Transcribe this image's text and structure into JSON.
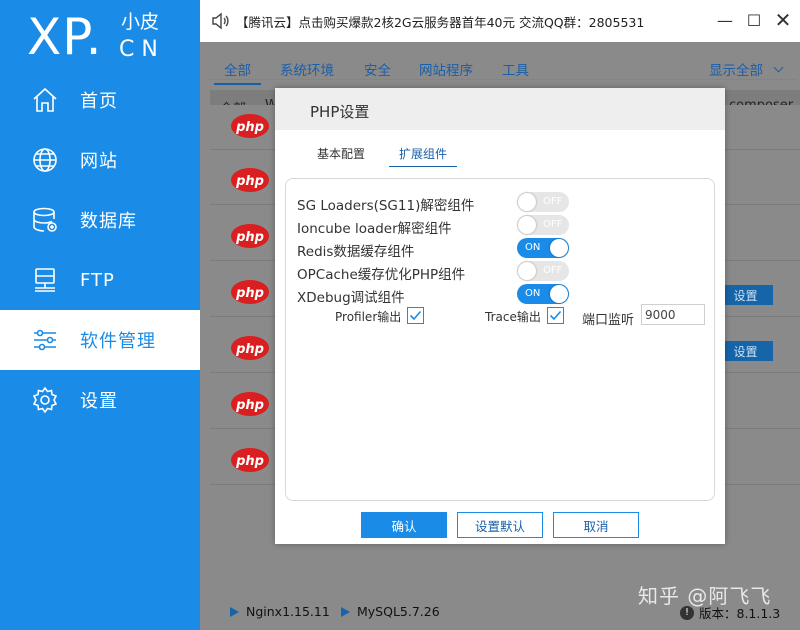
{
  "logo": {
    "main": "XP.",
    "small": "小皮",
    "cn": "CN"
  },
  "nav": [
    {
      "label": "首页",
      "icon": "home-icon"
    },
    {
      "label": "网站",
      "icon": "globe-icon"
    },
    {
      "label": "数据库",
      "icon": "database-icon"
    },
    {
      "label": "FTP",
      "icon": "server-icon"
    },
    {
      "label": "软件管理",
      "icon": "sliders-icon",
      "active": true
    },
    {
      "label": "设置",
      "icon": "gear-icon"
    }
  ],
  "topbar": {
    "notice": "【腾讯云】点击购买爆款2核2G云服务器首年40元 交流QQ群：2805531",
    "minimize": "—",
    "maximize": "☐",
    "close": "✕"
  },
  "tabs": [
    {
      "label": "全部",
      "active": true
    },
    {
      "label": "系统环境"
    },
    {
      "label": "安全"
    },
    {
      "label": "网站程序"
    },
    {
      "label": "工具"
    }
  ],
  "show_all": "显示全部",
  "list_header": {
    "all": "全部",
    "w": "W",
    "composer": "composer"
  },
  "php_logo_text": "php",
  "row_buttons": {
    "settings": "设置"
  },
  "status": {
    "nginx": "Nginx1.15.11",
    "mysql": "MySQL5.7.26",
    "watermark": "知乎 @阿飞飞",
    "version": "版本：8.1.1.3"
  },
  "modal": {
    "title": "PHP设置",
    "tabs": [
      {
        "label": "基本配置"
      },
      {
        "label": "扩展组件",
        "active": true
      }
    ],
    "extensions": [
      {
        "label": "SG Loaders(SG11)解密组件",
        "state": "OFF"
      },
      {
        "label": "Ioncube loader解密组件",
        "state": "OFF"
      },
      {
        "label": "Redis数据缓存组件",
        "state": "ON"
      },
      {
        "label": "OPCache缓存优化PHP组件",
        "state": "OFF"
      },
      {
        "label": "XDebug调试组件",
        "state": "ON"
      }
    ],
    "xdebug_options": {
      "profiler_label": "Profiler输出",
      "profiler_checked": true,
      "trace_label": "Trace输出",
      "trace_checked": true,
      "port_label": "端口监听",
      "port_value": "9000"
    },
    "buttons": {
      "confirm": "确认",
      "default": "设置默认",
      "cancel": "取消"
    }
  },
  "colors": {
    "brand": "#1a8be6",
    "link": "#1a5faa",
    "dim": "#8a8a8a"
  }
}
